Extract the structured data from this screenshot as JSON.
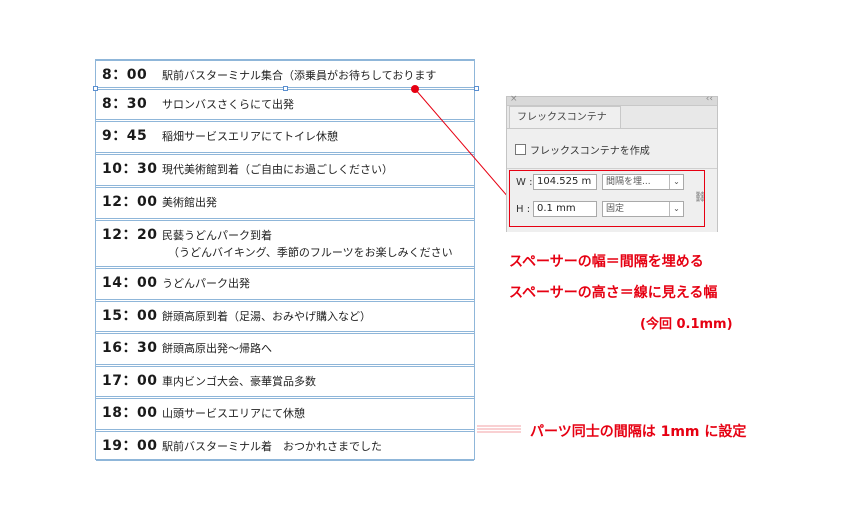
{
  "schedule": [
    {
      "time": "8：00",
      "desc": "駅前バスターミナル集合（添乗員がお待ちしております"
    },
    {
      "time": "8：30",
      "desc": "サロンバスさくらにて出発"
    },
    {
      "time": "9：45",
      "desc": "稲畑サービスエリアにてトイレ休憩"
    },
    {
      "time": "10：30",
      "desc": "現代美術館到着（ご自由にお過ごしください）"
    },
    {
      "time": "12：00",
      "desc": "美術館出発"
    },
    {
      "time": "12：20",
      "desc": "民藝うどんパーク到着",
      "desc2": "（うどんバイキング、季節のフルーツをお楽しみください"
    },
    {
      "time": "14：00",
      "desc": "うどんパーク出発"
    },
    {
      "time": "15：00",
      "desc": "餅頭高原到着（足湯、おみやげ購入など）"
    },
    {
      "time": "16：30",
      "desc": "餅頭高原出発〜帰路へ"
    },
    {
      "time": "17：00",
      "desc": "車内ビンゴ大会、豪華賞品多数"
    },
    {
      "time": "18：00",
      "desc": "山頭サービスエリアにて休憩"
    },
    {
      "time": "19：00",
      "desc": "駅前バスターミナル着　おつかれさまでした"
    }
  ],
  "panel": {
    "close_glyph": "×",
    "collapse_glyph": "‹‹",
    "tab_label": "フレックスコンテナ",
    "checkbox_label": "フレックスコンテナを作成",
    "w_label": "W :",
    "w_value": "104.525 m",
    "w_mode": "間隔を埋...",
    "h_label": "H :",
    "h_value": "0.1 mm",
    "h_mode": "固定",
    "dropdown_glyph": "⌄",
    "link_glyph": "⛓"
  },
  "annotations": {
    "line1": "スペーサーの幅＝間隔を埋める",
    "line2": "スペーサーの高さ＝線に見える幅",
    "line3": "(今回 0.1mm)",
    "line4": "パーツ同士の間隔は 1mm に設定"
  },
  "colors": {
    "accent_red": "#e60012",
    "guide_blue": "#8fb6d9"
  }
}
